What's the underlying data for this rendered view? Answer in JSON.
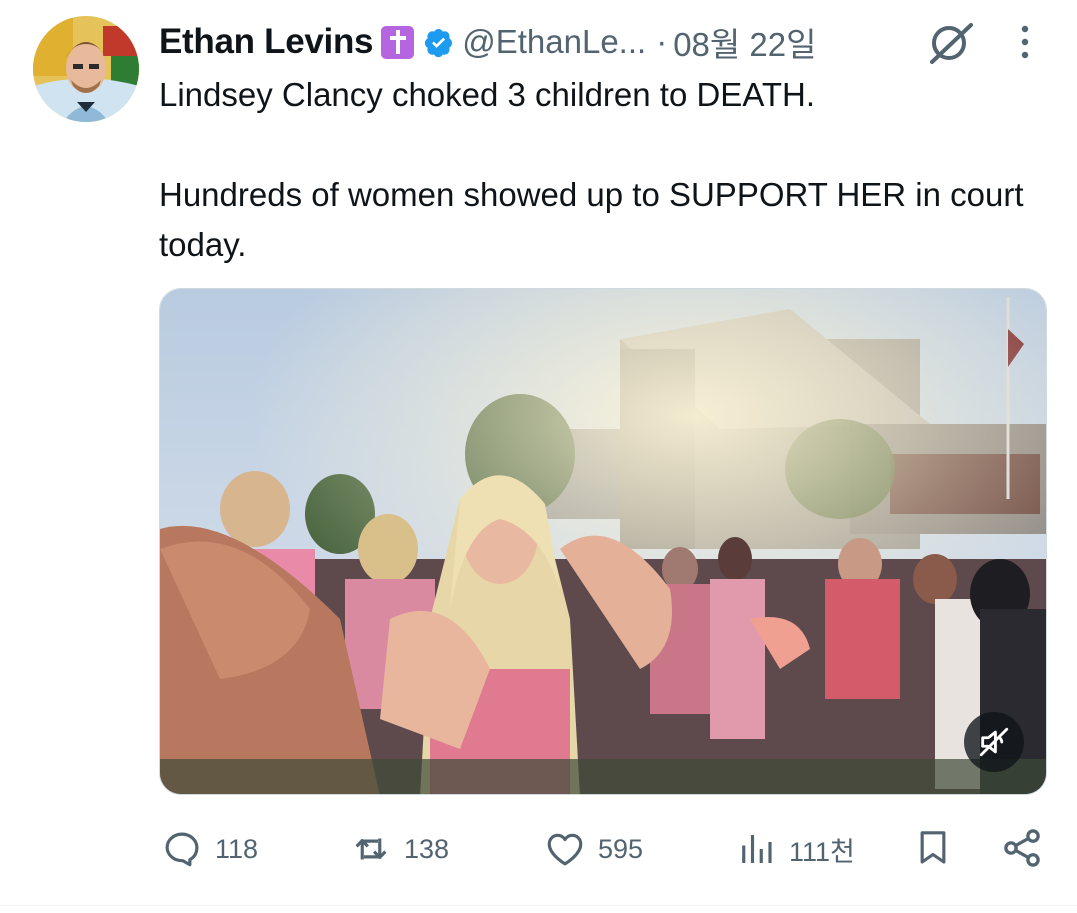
{
  "author": {
    "name": "Ethan Levins",
    "handle": "@EthanLe...",
    "separator": "·",
    "date": "08월 22일",
    "cross_badge_icon": "latin-cross",
    "verified": true
  },
  "tweet": {
    "line1": "Lindsey Clancy choked 3 children to DEATH.",
    "line2": "Hundreds of women showed up to SUPPORT HER in court today."
  },
  "actions": {
    "replies": "118",
    "reposts": "138",
    "likes": "595",
    "views": "111천"
  },
  "colors": {
    "text": "#0f1419",
    "secondary": "#536471",
    "verified_blue": "#1d9bf0",
    "cross_badge": "#b565e0"
  }
}
